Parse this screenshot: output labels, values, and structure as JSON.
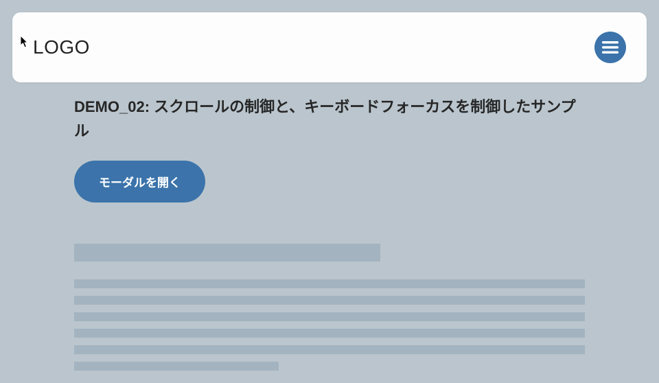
{
  "header": {
    "logo": "LOGO"
  },
  "main": {
    "title": "DEMO_02: スクロールの制御と、キーボードフォーカスを制御したサンプル",
    "open_modal_label": "モーダルを開く"
  },
  "colors": {
    "accent": "#3b73aa",
    "background": "#bac5cd",
    "skeleton": "#a3b4c0"
  }
}
